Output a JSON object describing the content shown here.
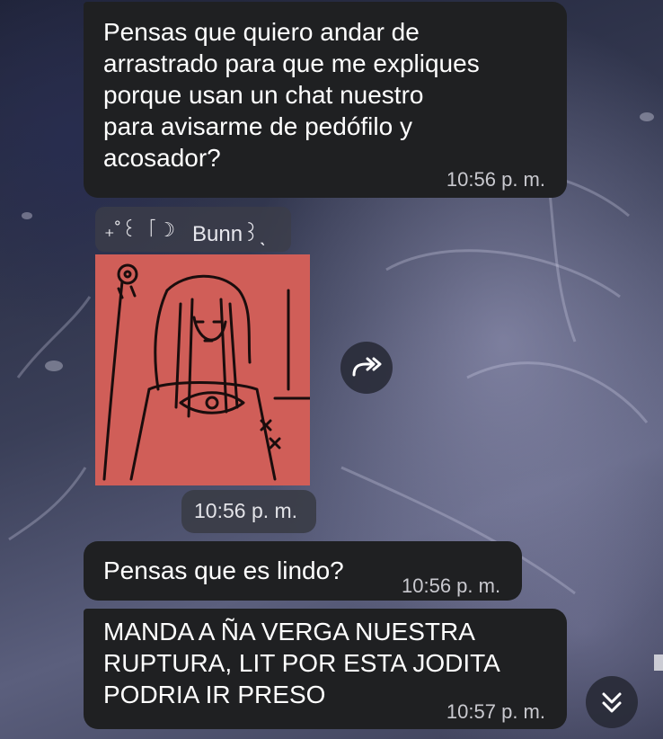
{
  "messages": [
    {
      "text": "Pensas que quiero andar de\narrastrado para que me expliques\nporque usan un chat nuestro\npara avisarme de pedófilo y\nacosador?",
      "time": "10:56 p. m."
    },
    {
      "sender_deco": "₊˚꒰ 「☽",
      "sender_name": "Bunn꒱ˎ",
      "type": "sticker",
      "time": "10:56 p. m."
    },
    {
      "text": "Pensas que es lindo?",
      "time": "10:56 p. m."
    },
    {
      "text": "MANDA A ÑA VERGA NUESTRA\nRUPTURA, LIT POR ESTA JODITA\nPODRIA IR PRESO",
      "time": "10:57 p. m."
    }
  ],
  "icons": {
    "forward": "forward-icon",
    "scroll_down": "double-chevron-down-icon"
  },
  "colors": {
    "bubble": "#1f2022",
    "sticker_background": "#d05e58",
    "text": "#ffffff",
    "timestamp": "#c9c9cf"
  }
}
